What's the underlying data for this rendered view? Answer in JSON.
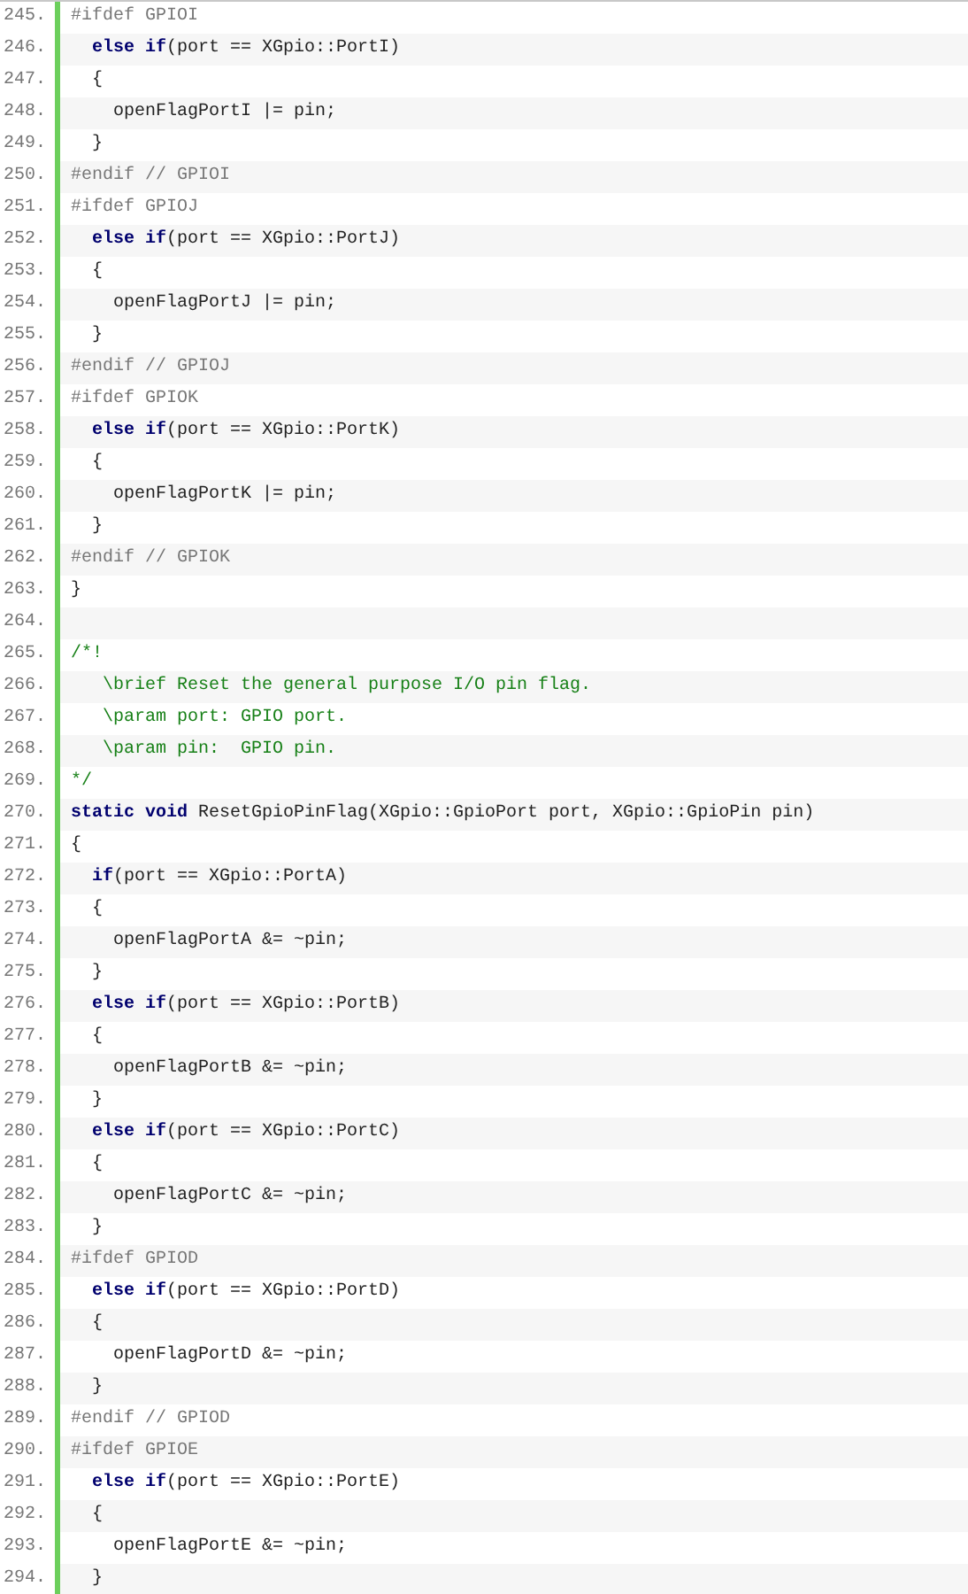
{
  "code_lines": [
    {
      "number": "245.",
      "parts": [
        {
          "kind": "preprocessor",
          "text": "#ifdef GPIOI"
        }
      ]
    },
    {
      "number": "246.",
      "parts": [
        {
          "kind": "keyword",
          "text": "  else if"
        },
        {
          "kind": "plain",
          "text": "(port == XGpio::PortI)"
        }
      ]
    },
    {
      "number": "247.",
      "parts": [
        {
          "kind": "plain",
          "text": "  {"
        }
      ]
    },
    {
      "number": "248.",
      "parts": [
        {
          "kind": "plain",
          "text": "    openFlagPortI |= pin;"
        }
      ]
    },
    {
      "number": "249.",
      "parts": [
        {
          "kind": "plain",
          "text": "  }"
        }
      ]
    },
    {
      "number": "250.",
      "parts": [
        {
          "kind": "preprocessor",
          "text": "#endif // GPIOI"
        }
      ]
    },
    {
      "number": "251.",
      "parts": [
        {
          "kind": "preprocessor",
          "text": "#ifdef GPIOJ"
        }
      ]
    },
    {
      "number": "252.",
      "parts": [
        {
          "kind": "keyword",
          "text": "  else if"
        },
        {
          "kind": "plain",
          "text": "(port == XGpio::PortJ)"
        }
      ]
    },
    {
      "number": "253.",
      "parts": [
        {
          "kind": "plain",
          "text": "  {"
        }
      ]
    },
    {
      "number": "254.",
      "parts": [
        {
          "kind": "plain",
          "text": "    openFlagPortJ |= pin;"
        }
      ]
    },
    {
      "number": "255.",
      "parts": [
        {
          "kind": "plain",
          "text": "  }"
        }
      ]
    },
    {
      "number": "256.",
      "parts": [
        {
          "kind": "preprocessor",
          "text": "#endif // GPIOJ"
        }
      ]
    },
    {
      "number": "257.",
      "parts": [
        {
          "kind": "preprocessor",
          "text": "#ifdef GPIOK"
        }
      ]
    },
    {
      "number": "258.",
      "parts": [
        {
          "kind": "keyword",
          "text": "  else if"
        },
        {
          "kind": "plain",
          "text": "(port == XGpio::PortK)"
        }
      ]
    },
    {
      "number": "259.",
      "parts": [
        {
          "kind": "plain",
          "text": "  {"
        }
      ]
    },
    {
      "number": "260.",
      "parts": [
        {
          "kind": "plain",
          "text": "    openFlagPortK |= pin;"
        }
      ]
    },
    {
      "number": "261.",
      "parts": [
        {
          "kind": "plain",
          "text": "  }"
        }
      ]
    },
    {
      "number": "262.",
      "parts": [
        {
          "kind": "preprocessor",
          "text": "#endif // GPIOK"
        }
      ]
    },
    {
      "number": "263.",
      "parts": [
        {
          "kind": "plain",
          "text": "}"
        }
      ]
    },
    {
      "number": "264."
    },
    {
      "number": "265.",
      "parts": [
        {
          "kind": "comment",
          "text": "/*!"
        }
      ]
    },
    {
      "number": "266.",
      "parts": [
        {
          "kind": "comment",
          "text": "   \\brief Reset the general purpose I/O pin flag."
        }
      ]
    },
    {
      "number": "267.",
      "parts": [
        {
          "kind": "comment",
          "text": "   \\param port: GPIO port."
        }
      ]
    },
    {
      "number": "268.",
      "parts": [
        {
          "kind": "comment",
          "text": "   \\param pin:  GPIO pin."
        }
      ]
    },
    {
      "number": "269.",
      "parts": [
        {
          "kind": "comment",
          "text": "*/"
        }
      ]
    },
    {
      "number": "270.",
      "parts": [
        {
          "kind": "keyword",
          "text": "static void"
        },
        {
          "kind": "plain",
          "text": " ResetGpioPinFlag(XGpio::GpioPort port, XGpio::GpioPin pin)"
        }
      ]
    },
    {
      "number": "271.",
      "parts": [
        {
          "kind": "plain",
          "text": "{"
        }
      ]
    },
    {
      "number": "272.",
      "parts": [
        {
          "kind": "keyword",
          "text": "  if"
        },
        {
          "kind": "plain",
          "text": "(port == XGpio::PortA)"
        }
      ]
    },
    {
      "number": "273.",
      "parts": [
        {
          "kind": "plain",
          "text": "  {"
        }
      ]
    },
    {
      "number": "274.",
      "parts": [
        {
          "kind": "plain",
          "text": "    openFlagPortA &= ~pin;"
        }
      ]
    },
    {
      "number": "275.",
      "parts": [
        {
          "kind": "plain",
          "text": "  }"
        }
      ]
    },
    {
      "number": "276.",
      "parts": [
        {
          "kind": "keyword",
          "text": "  else if"
        },
        {
          "kind": "plain",
          "text": "(port == XGpio::PortB)"
        }
      ]
    },
    {
      "number": "277.",
      "parts": [
        {
          "kind": "plain",
          "text": "  {"
        }
      ]
    },
    {
      "number": "278.",
      "parts": [
        {
          "kind": "plain",
          "text": "    openFlagPortB &= ~pin;"
        }
      ]
    },
    {
      "number": "279.",
      "parts": [
        {
          "kind": "plain",
          "text": "  }"
        }
      ]
    },
    {
      "number": "280.",
      "parts": [
        {
          "kind": "keyword",
          "text": "  else if"
        },
        {
          "kind": "plain",
          "text": "(port == XGpio::PortC)"
        }
      ]
    },
    {
      "number": "281.",
      "parts": [
        {
          "kind": "plain",
          "text": "  {"
        }
      ]
    },
    {
      "number": "282.",
      "parts": [
        {
          "kind": "plain",
          "text": "    openFlagPortC &= ~pin;"
        }
      ]
    },
    {
      "number": "283.",
      "parts": [
        {
          "kind": "plain",
          "text": "  }"
        }
      ]
    },
    {
      "number": "284.",
      "parts": [
        {
          "kind": "preprocessor",
          "text": "#ifdef GPIOD"
        }
      ]
    },
    {
      "number": "285.",
      "parts": [
        {
          "kind": "keyword",
          "text": "  else if"
        },
        {
          "kind": "plain",
          "text": "(port == XGpio::PortD)"
        }
      ]
    },
    {
      "number": "286.",
      "parts": [
        {
          "kind": "plain",
          "text": "  {"
        }
      ]
    },
    {
      "number": "287.",
      "parts": [
        {
          "kind": "plain",
          "text": "    openFlagPortD &= ~pin;"
        }
      ]
    },
    {
      "number": "288.",
      "parts": [
        {
          "kind": "plain",
          "text": "  }"
        }
      ]
    },
    {
      "number": "289.",
      "parts": [
        {
          "kind": "preprocessor",
          "text": "#endif // GPIOD"
        }
      ]
    },
    {
      "number": "290.",
      "parts": [
        {
          "kind": "preprocessor",
          "text": "#ifdef GPIOE"
        }
      ]
    },
    {
      "number": "291.",
      "parts": [
        {
          "kind": "keyword",
          "text": "  else if"
        },
        {
          "kind": "plain",
          "text": "(port == XGpio::PortE)"
        }
      ]
    },
    {
      "number": "292.",
      "parts": [
        {
          "kind": "plain",
          "text": "  {"
        }
      ]
    },
    {
      "number": "293.",
      "parts": [
        {
          "kind": "plain",
          "text": "    openFlagPortE &= ~pin;"
        }
      ]
    },
    {
      "number": "294.",
      "parts": [
        {
          "kind": "plain",
          "text": "  }"
        }
      ]
    }
  ]
}
